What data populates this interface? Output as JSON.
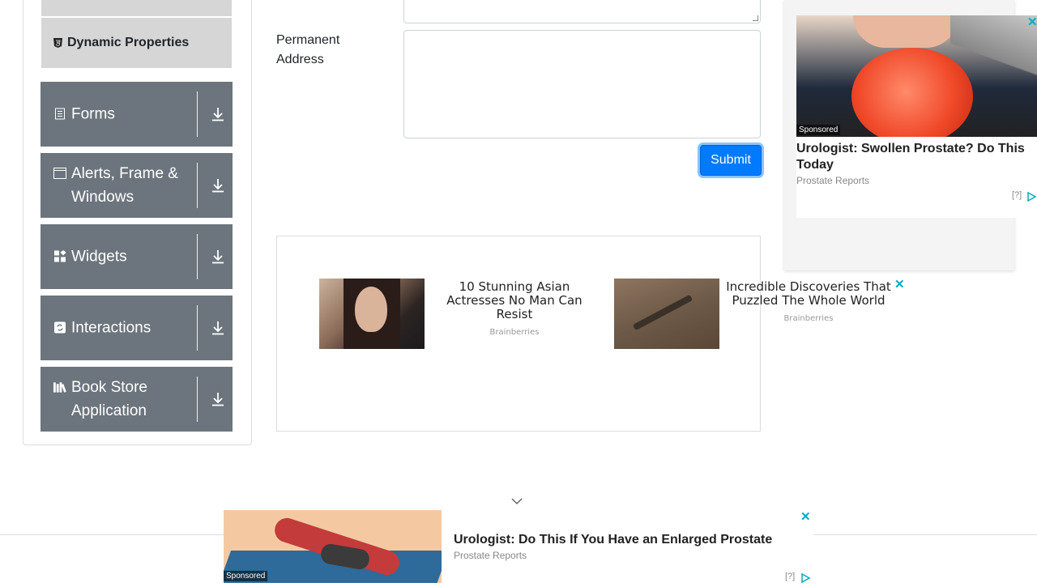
{
  "sidebar": {
    "sub_item": {
      "label": "Dynamic Properties"
    },
    "groups": [
      {
        "label": "Forms",
        "icon": "form-icon"
      },
      {
        "label": "Alerts, Frame & Windows",
        "icon": "window-icon"
      },
      {
        "label": "Widgets",
        "icon": "widgets-icon"
      },
      {
        "label": "Interactions",
        "icon": "interactions-icon"
      },
      {
        "label": "Book Store Application",
        "icon": "books-icon"
      }
    ]
  },
  "form": {
    "permanent_address_label": "Permanent Address",
    "permanent_address_value": "",
    "submit_label": "Submit"
  },
  "ads": {
    "middle": [
      {
        "title": "10 Stunning Asian Actresses No Man Can Resist",
        "source": "Brainberries"
      },
      {
        "title": "Incredible Discoveries That Puzzled The Whole World",
        "source": "Brainberries"
      }
    ],
    "right": {
      "sponsored": "Sponsored",
      "title": "Urologist: Swollen Prostate? Do This Today",
      "source": "Prostate Reports",
      "info": "[?]"
    },
    "bottom": {
      "sponsored": "Sponsored",
      "title": "Urologist: Do This If You Have an Enlarged Prostate",
      "source": "Prostate Reports",
      "info": "[?]"
    },
    "close_glyph": "✕"
  },
  "colors": {
    "group_bg": "#6c757d",
    "sub_item_bg": "#d6d6d6",
    "submit_bg": "#007bff",
    "ad_close": "#00aac8"
  }
}
